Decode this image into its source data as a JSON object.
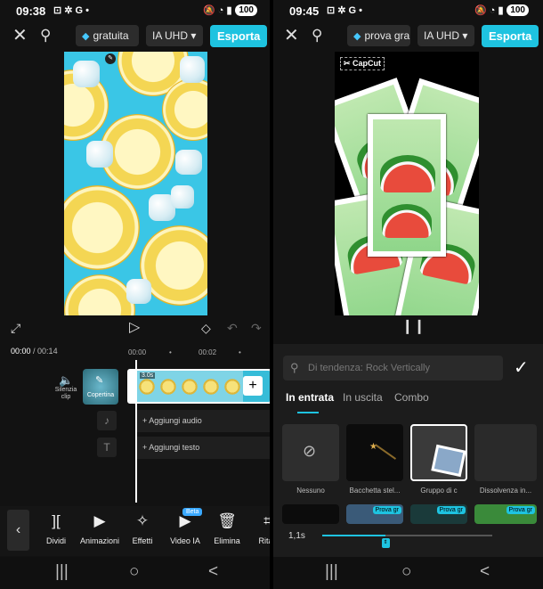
{
  "left": {
    "status": {
      "time": "09:38",
      "icons": "⊡ ✲ G •",
      "right_icons": "🔕 ◔ ▮",
      "battery": "100"
    },
    "topbar": {
      "close_icon": "close-icon",
      "search_icon": "search-icon",
      "pro_pill": "gratuita",
      "quality": "IA UHD",
      "export": "Esporta"
    },
    "timeline": {
      "current": "00:00",
      "sep": " / ",
      "total": "00:14",
      "ruler": [
        "00:00",
        "•",
        "00:02",
        "•"
      ],
      "mute_label": "Silenzia clip",
      "cover_label": "Copertina",
      "clip_duration": "3.0s",
      "add_audio": "Aggiungi audio",
      "add_text": "Aggiungi testo"
    },
    "tools": [
      {
        "icon": "split-icon",
        "glyph": "][",
        "label": "Dividi"
      },
      {
        "icon": "animation-icon",
        "glyph": "▶",
        "label": "Animazioni"
      },
      {
        "icon": "effects-icon",
        "glyph": "✧",
        "label": "Effetti"
      },
      {
        "icon": "video-ai-icon",
        "glyph": "▶",
        "label": "Video IA"
      },
      {
        "icon": "delete-icon",
        "glyph": "🗑",
        "label": "Elimina"
      },
      {
        "icon": "crop-icon",
        "glyph": "⌗",
        "label": "Ritag"
      }
    ],
    "beta_badge": "Beta"
  },
  "right": {
    "status": {
      "time": "09:45",
      "icons": "⊡ ✲ G •",
      "right_icons": "🔕 ◔ ▮",
      "battery": "100"
    },
    "topbar": {
      "pro_pill": "prova gra",
      "quality": "IA UHD",
      "export": "Esporta"
    },
    "watermark": "CapCut",
    "search_placeholder": "Di tendenza: Rock Vertically",
    "tabs": [
      "In entrata",
      "In uscita",
      "Combo"
    ],
    "animations": [
      {
        "label": "Nessuno"
      },
      {
        "label": "Bacchetta stel..."
      },
      {
        "label": "Gruppo di c"
      },
      {
        "label": "Dissolvenza in..."
      }
    ],
    "pro_tags": [
      "Prova gr",
      "Prova gr",
      "Prova gr"
    ],
    "duration": "1,1s",
    "slider_value": 0.37
  },
  "navbar": {
    "recent": "|||",
    "home": "○",
    "back": "<"
  }
}
